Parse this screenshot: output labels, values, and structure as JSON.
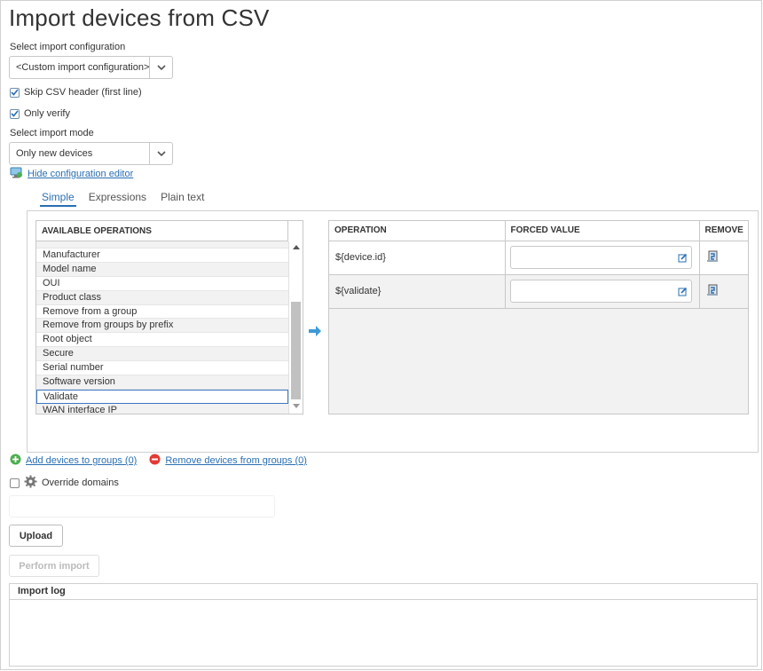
{
  "page": {
    "title": "Import devices from CSV"
  },
  "config": {
    "label": "Select import configuration",
    "selected": "<Custom import configuration>"
  },
  "options": {
    "skip_header": {
      "label": "Skip CSV header (first line)",
      "checked": true
    },
    "only_verify": {
      "label": "Only verify",
      "checked": true
    }
  },
  "mode": {
    "label": "Select import mode",
    "selected": "Only new devices"
  },
  "editor_link": "Hide configuration editor",
  "tabs": [
    {
      "label": "Simple",
      "active": true
    },
    {
      "label": "Expressions",
      "active": false
    },
    {
      "label": "Plain text",
      "active": false
    }
  ],
  "available": {
    "header": "AVAILABLE OPERATIONS",
    "items": [
      "Manufacturer",
      "Model name",
      "OUI",
      "Product class",
      "Remove from a group",
      "Remove from groups by prefix",
      "Root object",
      "Secure",
      "Serial number",
      "Software version",
      "Validate",
      "WAN interface IP"
    ],
    "selected": "Validate"
  },
  "operations": {
    "headers": {
      "operation": "OPERATION",
      "forced_value": "FORCED VALUE",
      "remove": "REMOVE"
    },
    "rows": [
      {
        "operation": "${device.id}",
        "forced_value": ""
      },
      {
        "operation": "${validate}",
        "forced_value": ""
      }
    ]
  },
  "groups": {
    "add_label": "Add devices to groups (0)",
    "remove_label": "Remove devices from groups (0)"
  },
  "override": {
    "label": "Override domains",
    "checked": false
  },
  "buttons": {
    "upload": "Upload",
    "perform": "Perform import"
  },
  "log": {
    "title": "Import log"
  },
  "colors": {
    "link": "#2a6fb2",
    "arrow": "#3d9ad6",
    "add": "#4caf50",
    "remove": "#e53935"
  }
}
